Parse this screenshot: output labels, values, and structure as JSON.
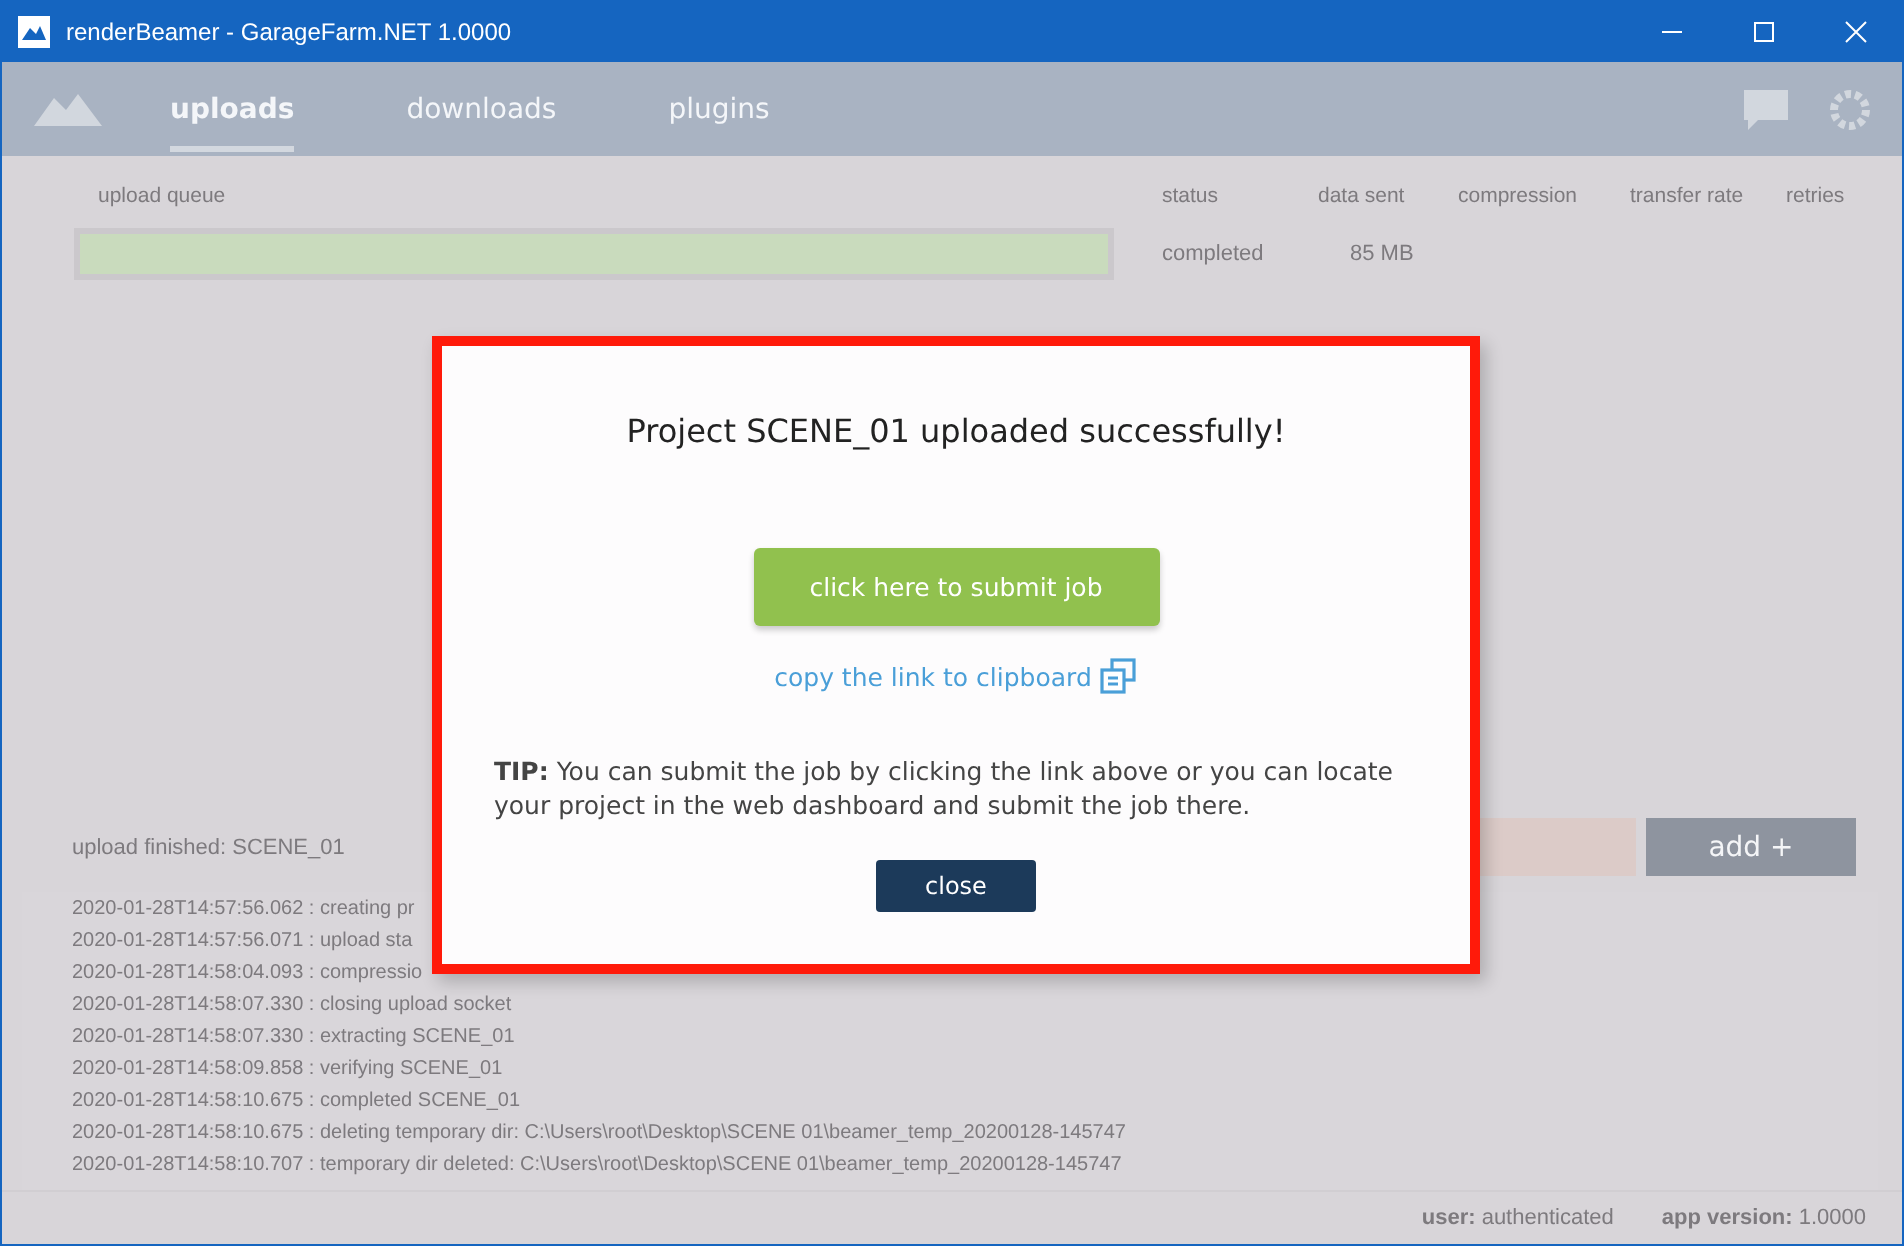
{
  "window": {
    "title": "renderBeamer - GarageFarm.NET 1.0000"
  },
  "nav": {
    "tabs": [
      {
        "label": "uploads",
        "selected": true
      },
      {
        "label": "downloads",
        "selected": false
      },
      {
        "label": "plugins",
        "selected": false
      }
    ]
  },
  "queue": {
    "columns": [
      "upload queue",
      "status",
      "data sent",
      "compression",
      "transfer rate",
      "retries"
    ],
    "rows": [
      {
        "level": 1,
        "status": "completed",
        "data_sent": "85 MB"
      }
    ]
  },
  "upload_status": "upload finished: SCENE_01",
  "add_button": "add +",
  "log": [
    "2020-01-28T14:57:56.062 : creating pr",
    "2020-01-28T14:57:56.071 : upload sta",
    "2020-01-28T14:58:04.093 : compressio",
    "2020-01-28T14:58:07.330 : closing upload socket",
    "2020-01-28T14:58:07.330 : extracting SCENE_01",
    "2020-01-28T14:58:09.858 : verifying SCENE_01",
    "2020-01-28T14:58:10.675 : completed SCENE_01",
    "2020-01-28T14:58:10.675 : deleting temporary dir: C:\\Users\\root\\Desktop\\SCENE 01\\beamer_temp_20200128-145747",
    "2020-01-28T14:58:10.707 : temporary dir deleted: C:\\Users\\root\\Desktop\\SCENE 01\\beamer_temp_20200128-145747"
  ],
  "status_bar": {
    "user_label": "user:",
    "user_value": "authenticated",
    "version_label": "app version:",
    "version_value": "1.0000"
  },
  "dialog": {
    "heading": "Project SCENE_01 uploaded successfully!",
    "submit_button": "click here to submit job",
    "copy_link": "copy the link to clipboard",
    "tip": "**TIP:** You can submit the job by clicking the link above or you can locate your project in the web dashboard and submit the job there.",
    "close_button": "close"
  }
}
